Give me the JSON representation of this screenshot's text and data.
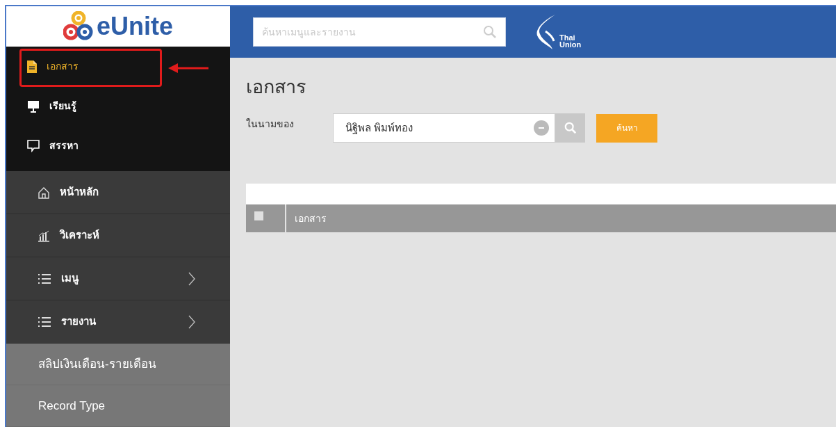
{
  "logo": {
    "text": "eUnite"
  },
  "search": {
    "placeholder": "ค้นหาเมนูและรายงาน"
  },
  "brand": {
    "line_1": "Thai",
    "line_2": "Union"
  },
  "sidebar": {
    "groups": [
      {
        "kind": "apps",
        "items": [
          {
            "label": "เอกสาร",
            "kind": "document",
            "selected": true,
            "annotated": true
          },
          {
            "label": "เรียนรู้",
            "kind": "board",
            "selected": false,
            "annotated": false
          },
          {
            "label": "สรรหา",
            "kind": "chat",
            "selected": false,
            "annotated": false
          }
        ]
      },
      {
        "kind": "nav",
        "items": [
          {
            "label": "หน้าหลัก",
            "kind": "home",
            "expandable": false
          },
          {
            "label": "วิเคราะห์",
            "kind": "chart",
            "expandable": false
          },
          {
            "label": "เมนู",
            "kind": "list",
            "expandable": true
          },
          {
            "label": "รายงาน",
            "kind": "list",
            "expandable": true
          }
        ]
      },
      {
        "kind": "links",
        "items": [
          {
            "label": "สลิปเงินเดือน-รายเดือน"
          },
          {
            "label": "Record Type"
          }
        ]
      }
    ]
  },
  "page": {
    "title": "เอกสาร",
    "filter_label": "ในนามของ",
    "person_field": {
      "value": "นิฐิพล พิมพ์ทอง"
    },
    "search_button": "ค้นหา"
  },
  "table": {
    "header_checkbox": {
      "checked": false
    },
    "columns": [
      "เอกสาร"
    ]
  }
}
